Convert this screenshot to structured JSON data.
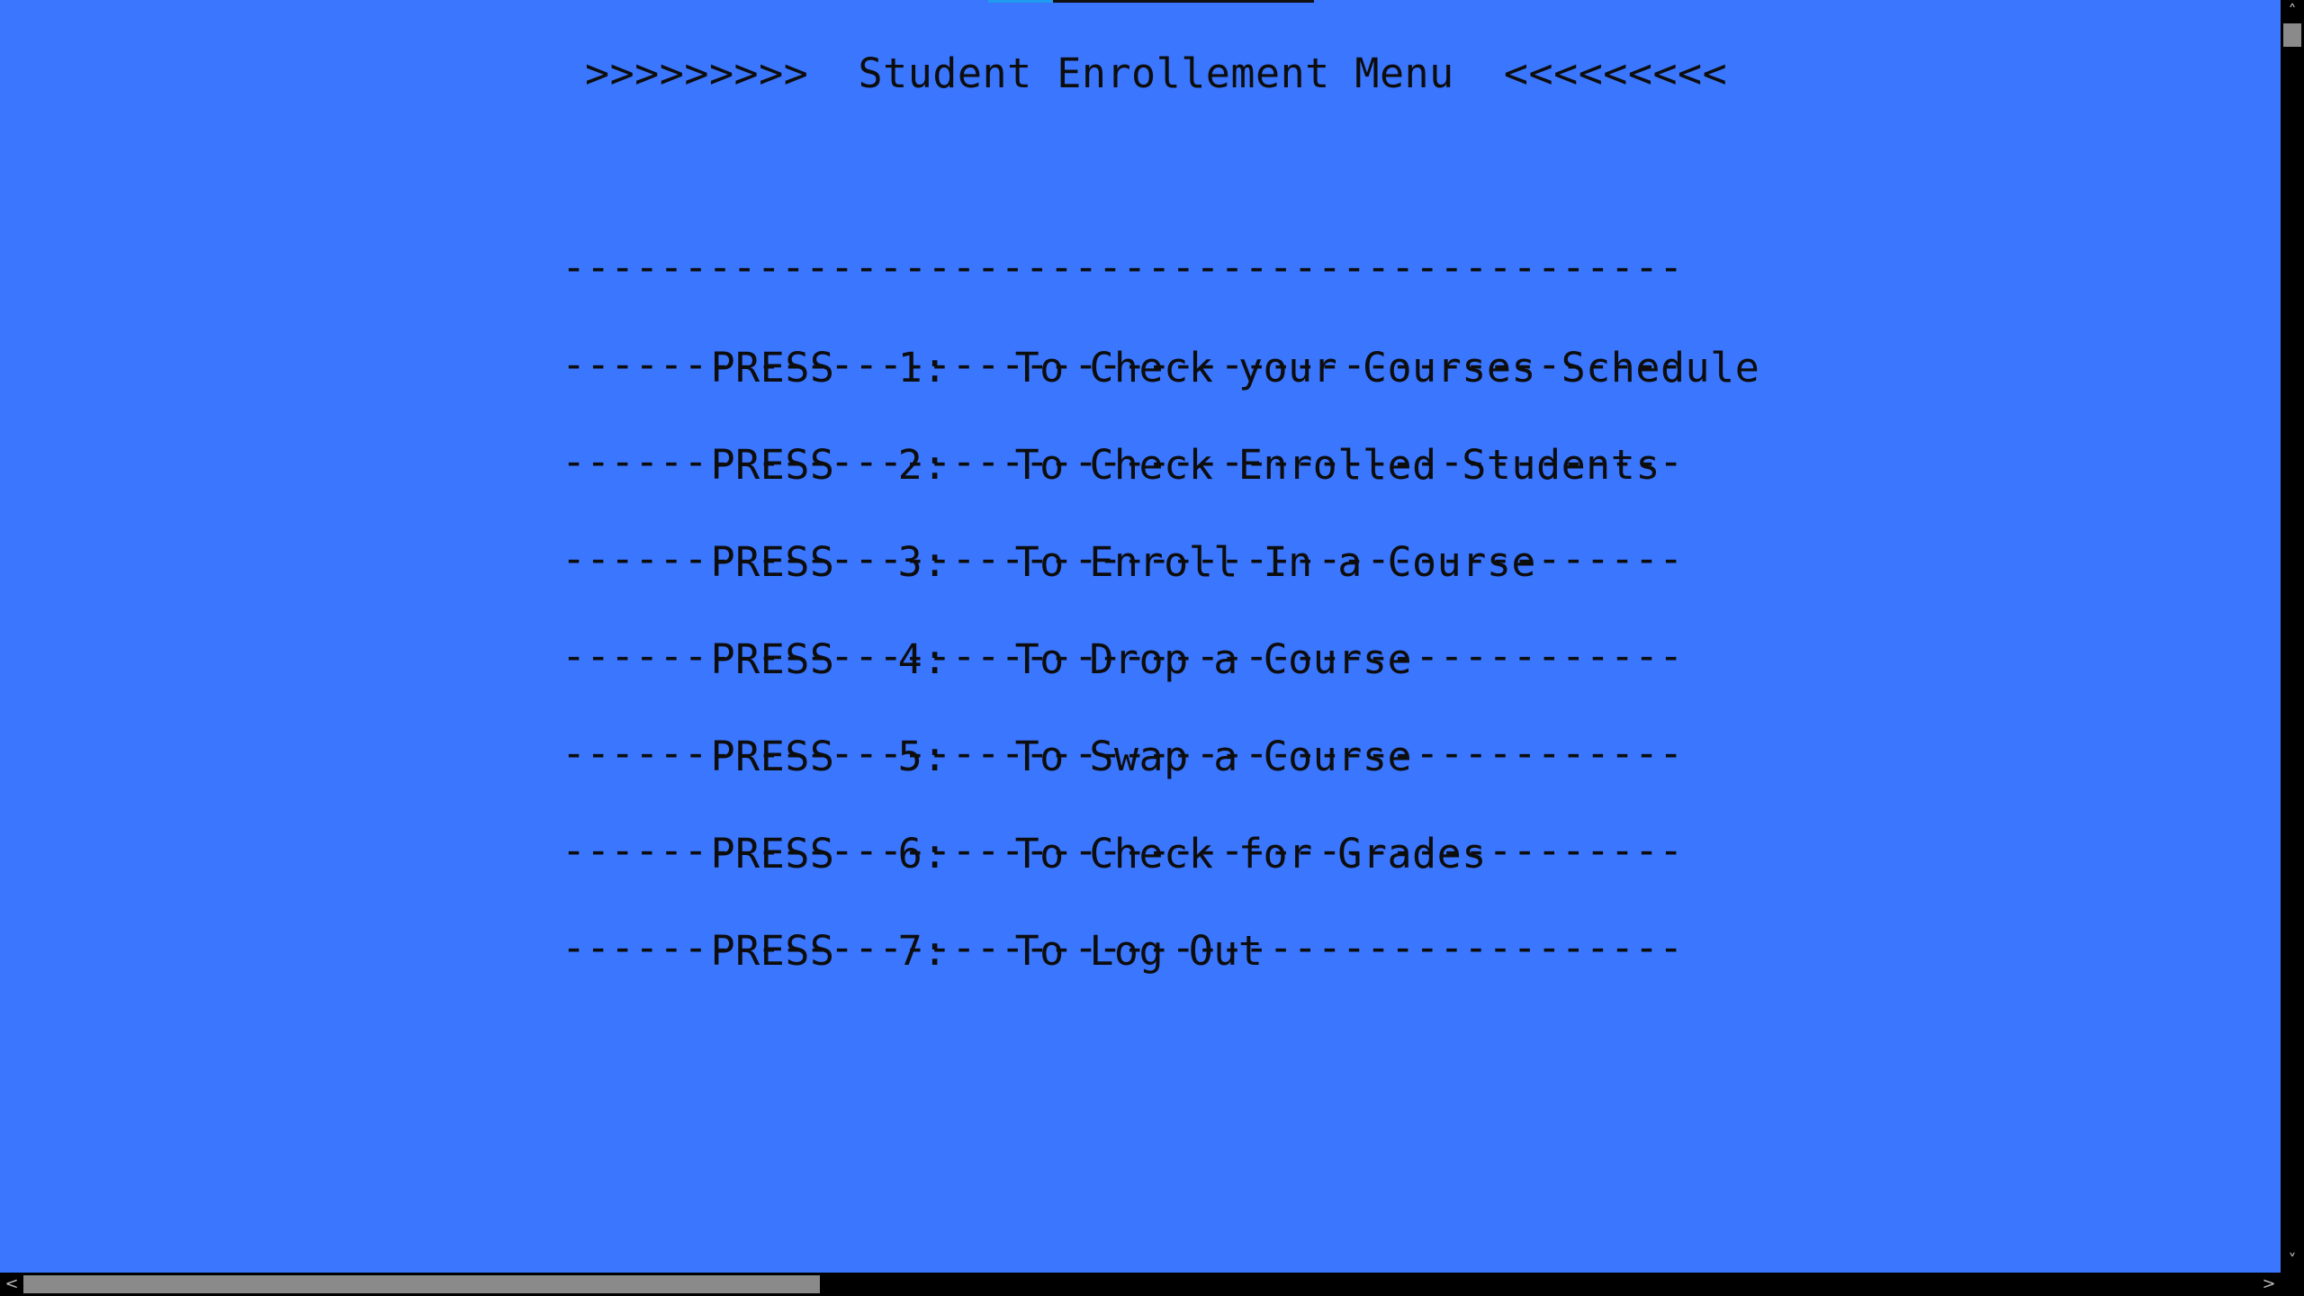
{
  "title": ">>>>>>>>>  Student Enrollement Menu  <<<<<<<<<",
  "separator": "-------------------------------------------------",
  "menu": {
    "items": [
      {
        "press": "PRESS",
        "key": "1:",
        "label": "To Check your Courses Schedule"
      },
      {
        "press": "PRESS",
        "key": "2:",
        "label": "To Check Enrolled Students"
      },
      {
        "press": "PRESS",
        "key": "3:",
        "label": "To Enroll In a Course"
      },
      {
        "press": "PRESS",
        "key": "4:",
        "label": "To Drop a Course"
      },
      {
        "press": "PRESS",
        "key": "5:",
        "label": "To Swap a Course"
      },
      {
        "press": "PRESS",
        "key": "6:",
        "label": "To Check for Grades"
      },
      {
        "press": "PRESS",
        "key": "7:",
        "label": "To Log Out"
      }
    ]
  },
  "scrollbars": {
    "up_icon": "chevron-up-icon",
    "down_icon": "chevron-down-icon",
    "left_icon": "chevron-left-icon",
    "right_icon": "chevron-right-icon",
    "up_glyph": "˄",
    "down_glyph": "˅",
    "left_glyph": "<",
    "right_glyph": ">"
  },
  "colors": {
    "background": "#3b76ff",
    "text": "#0d0d0d",
    "scrollbar": "#000000",
    "thumb": "#8a8a8a"
  }
}
